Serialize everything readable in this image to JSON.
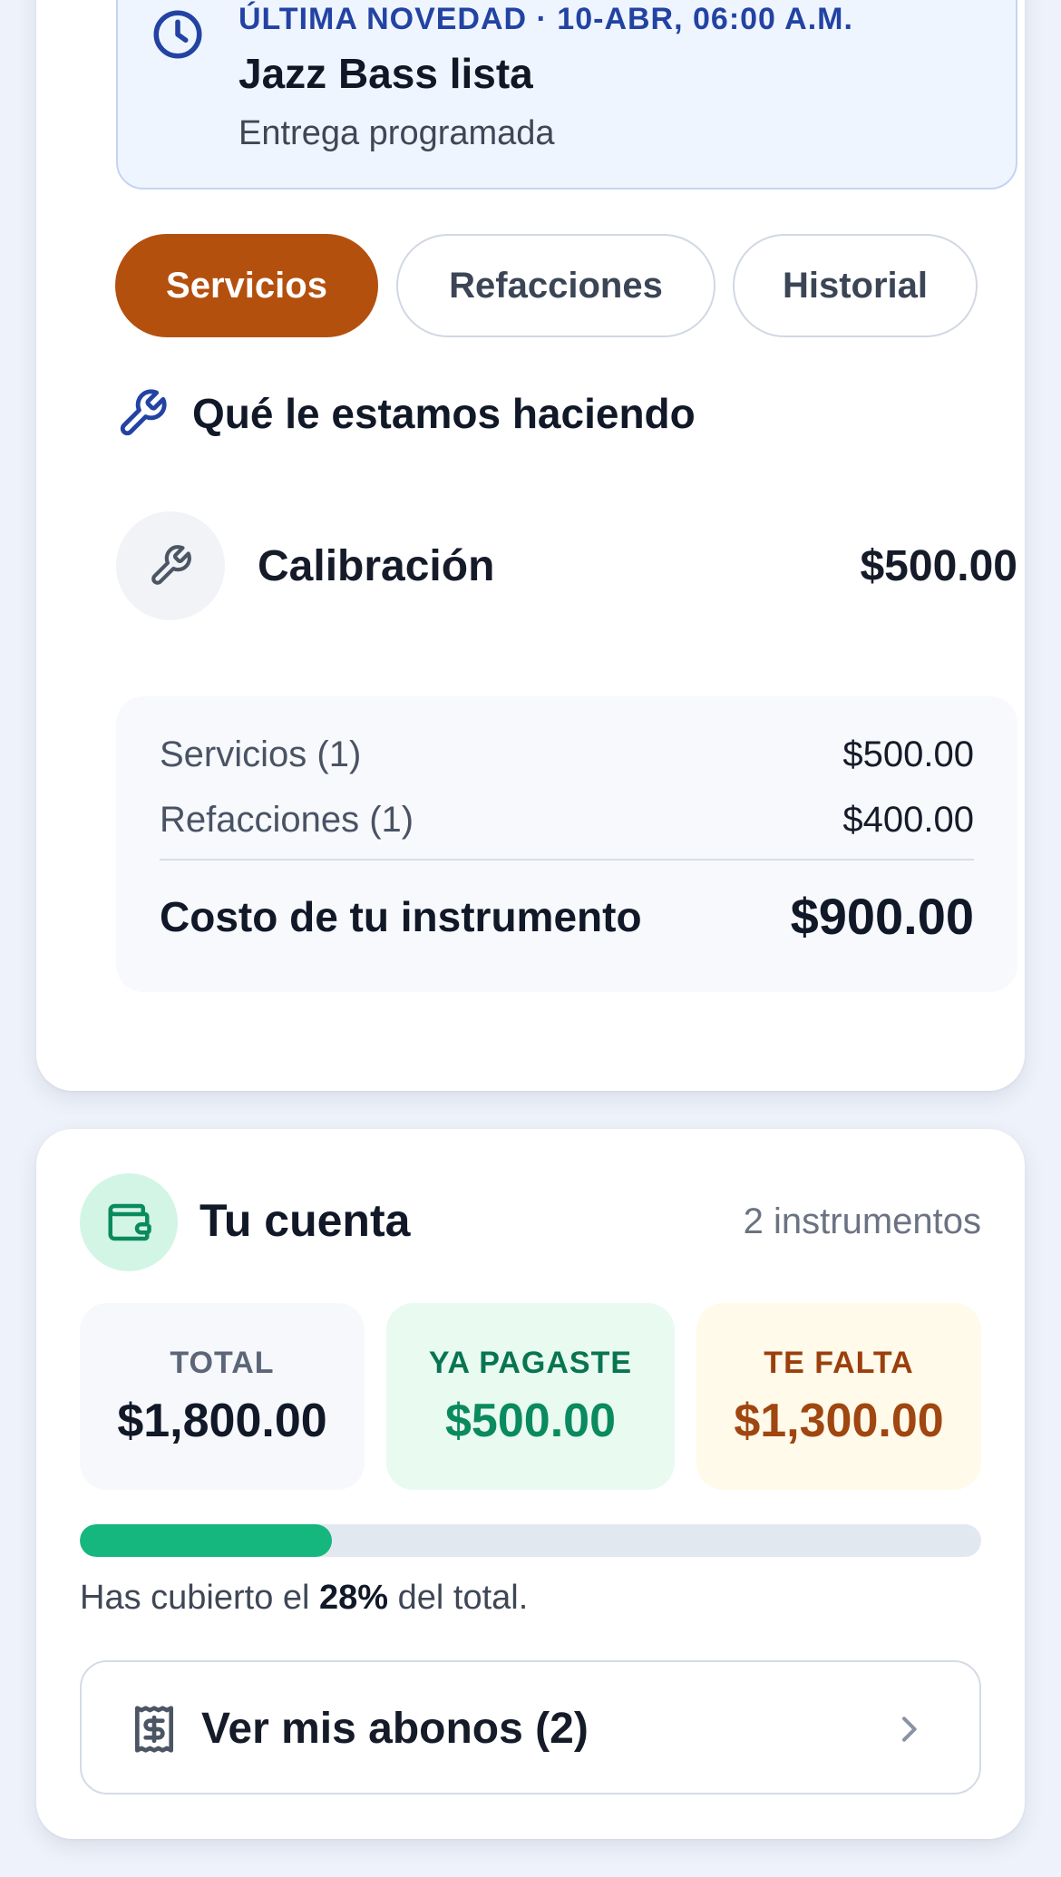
{
  "update": {
    "kicker": "ÚLTIMA NOVEDAD · 10-ABR, 06:00 A.M.",
    "title": "Jazz Bass lista",
    "subtitle": "Entrega programada",
    "icon": "clock-icon"
  },
  "tabs": [
    {
      "label": "Servicios",
      "active": true
    },
    {
      "label": "Refacciones",
      "active": false
    },
    {
      "label": "Historial",
      "active": false
    }
  ],
  "section": {
    "title": "Qué le estamos haciendo",
    "icon": "wrench-icon"
  },
  "services": [
    {
      "name": "Calibración",
      "price": "$500.00",
      "icon": "wrench-icon"
    }
  ],
  "summary": {
    "rows": [
      {
        "label": "Servicios (1)",
        "value": "$500.00"
      },
      {
        "label": "Refacciones (1)",
        "value": "$400.00"
      }
    ],
    "total_label": "Costo de tu instrumento",
    "total_value": "$900.00"
  },
  "account": {
    "title": "Tu cuenta",
    "count": "2 instrumentos",
    "icon": "wallet-icon",
    "stats": {
      "total": {
        "label": "TOTAL",
        "value": "$1,800.00"
      },
      "paid": {
        "label": "YA PAGASTE",
        "value": "$500.00"
      },
      "due": {
        "label": "TE FALTA",
        "value": "$1,300.00"
      }
    },
    "progress_percent": 28,
    "progress_prefix": "Has cubierto el ",
    "progress_value": "28%",
    "progress_suffix": " del total.",
    "abonos_label": "Ver mis abonos (2)"
  },
  "colors": {
    "accent": "#b4500e",
    "paid": "#16b67f",
    "due": "#a04610",
    "update_bg": "#eff5ff"
  }
}
